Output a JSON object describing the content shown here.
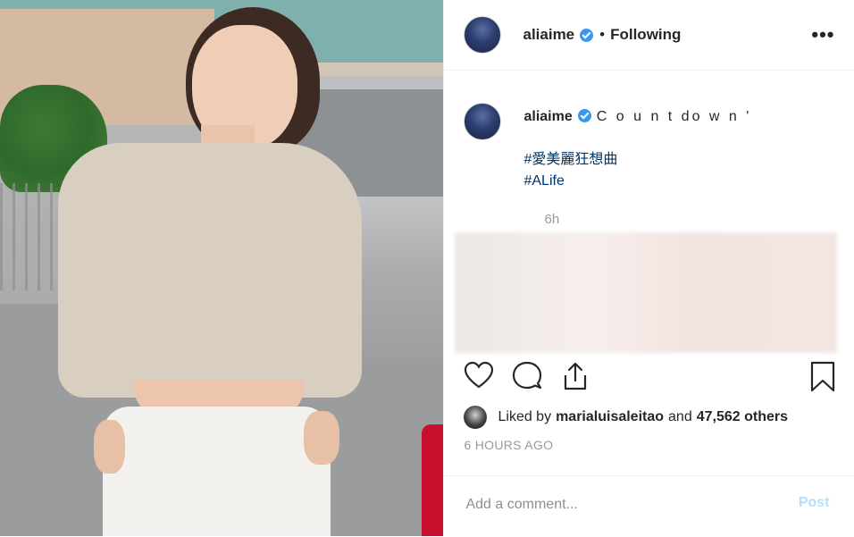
{
  "header": {
    "username": "aliaime",
    "separator": "•",
    "follow_status": "Following",
    "more_label": "•••"
  },
  "caption": {
    "username": "aliaime",
    "text": "C o u n t do w n '",
    "hashtags": [
      "#愛美麗狂想曲",
      "#ALife"
    ],
    "time": "6h"
  },
  "actions": {
    "like_icon": "heart-icon",
    "comment_icon": "comment-bubble-icon",
    "share_icon": "share-icon",
    "save_icon": "bookmark-icon"
  },
  "likes": {
    "prefix": "Liked by",
    "user": "marialuisaleitao",
    "conjunction": "and",
    "others": "47,562 others"
  },
  "post_age": "6 HOURS AGO",
  "comment": {
    "placeholder": "Add a comment...",
    "post_label": "Post"
  },
  "colors": {
    "verified": "#3897f0",
    "hashtag": "#003569",
    "muted": "#999999",
    "post_disabled": "#b2dffc"
  }
}
